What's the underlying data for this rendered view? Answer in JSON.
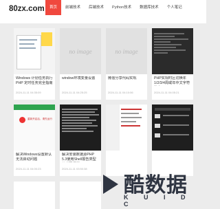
{
  "site": {
    "logo": "80zx.com"
  },
  "nav": [
    "首页",
    "前端技术",
    "后端技术",
    "Python技术",
    "数据库技术",
    "个人笔记"
  ],
  "posts": [
    {
      "title": "Windows 计划任务执行 PHP 定时任务完全指南",
      "date": "2024-11-11 04:35:09",
      "thumb": "screenshot"
    },
    {
      "title": "window环境变量设置",
      "date": "2024-11-11 04:25:25",
      "thumb": "no image"
    },
    {
      "title": "微信分享代码实现",
      "date": "2024-11-11 04:10:06",
      "thumb": "no image"
    },
    {
      "title": "PHP实现时区切换年 1/2/3/4周或年中文字符数字一二三四",
      "date": "2024-11-11 04:05:21",
      "thumb": "code"
    },
    {
      "title": "解决Windows设置默认无法启动问题",
      "date": "2024-11-11 04:00:23",
      "thumb": "win"
    },
    {
      "title": "解决安装数据源PHP 5.3使用Shell报告类型的代码问题",
      "date": "2024-11-11 03:50:38",
      "thumb": "code"
    },
    {
      "title": "",
      "date": "",
      "thumb": "filelist"
    },
    {
      "title": "",
      "date": "",
      "thumb": "table"
    }
  ],
  "no_image_label": "no image",
  "win_dialog_text": "重新开启后，请先运行",
  "watermark": {
    "main": "酷数据",
    "sub": "K U I D C"
  },
  "colors": {
    "accent": "#f0483e",
    "dark": "#2f3542"
  }
}
